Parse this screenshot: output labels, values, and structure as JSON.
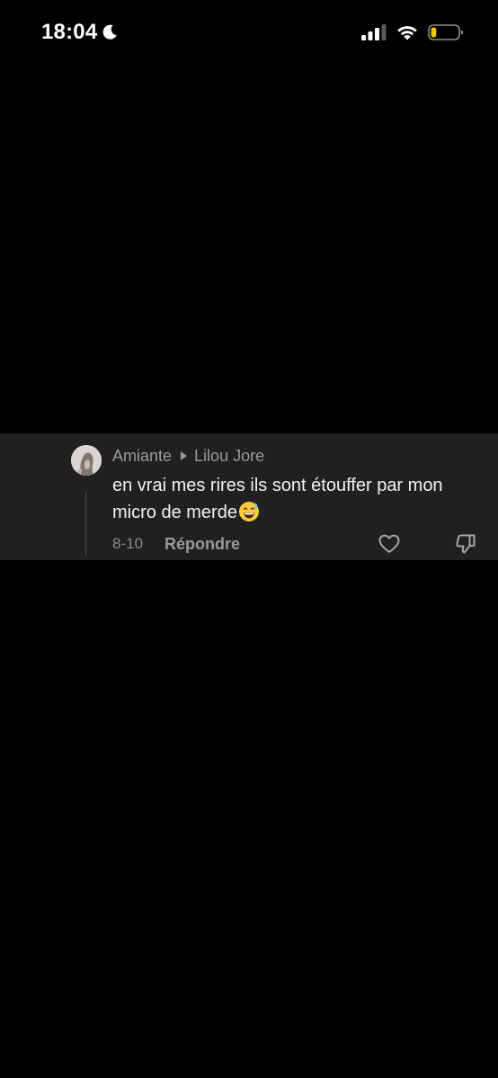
{
  "status_bar": {
    "time": "18:04",
    "moon_icon": "moon-icon",
    "signal_icon": "cellular-signal-icon",
    "wifi_icon": "wifi-icon",
    "battery_icon": "battery-low-icon",
    "battery_color": "#F5C400",
    "battery_level": 0.2
  },
  "comment": {
    "author": "Amiante",
    "reply_to": "Lilou Jore",
    "text": "en vrai mes rires ils sont étouffer par mon micro de merde",
    "emoji": "😅",
    "date": "8-10",
    "reply_label": "Répondre",
    "like_icon": "heart-outline-icon",
    "dislike_icon": "thumbs-down-outline-icon",
    "card_color": "#202020"
  }
}
